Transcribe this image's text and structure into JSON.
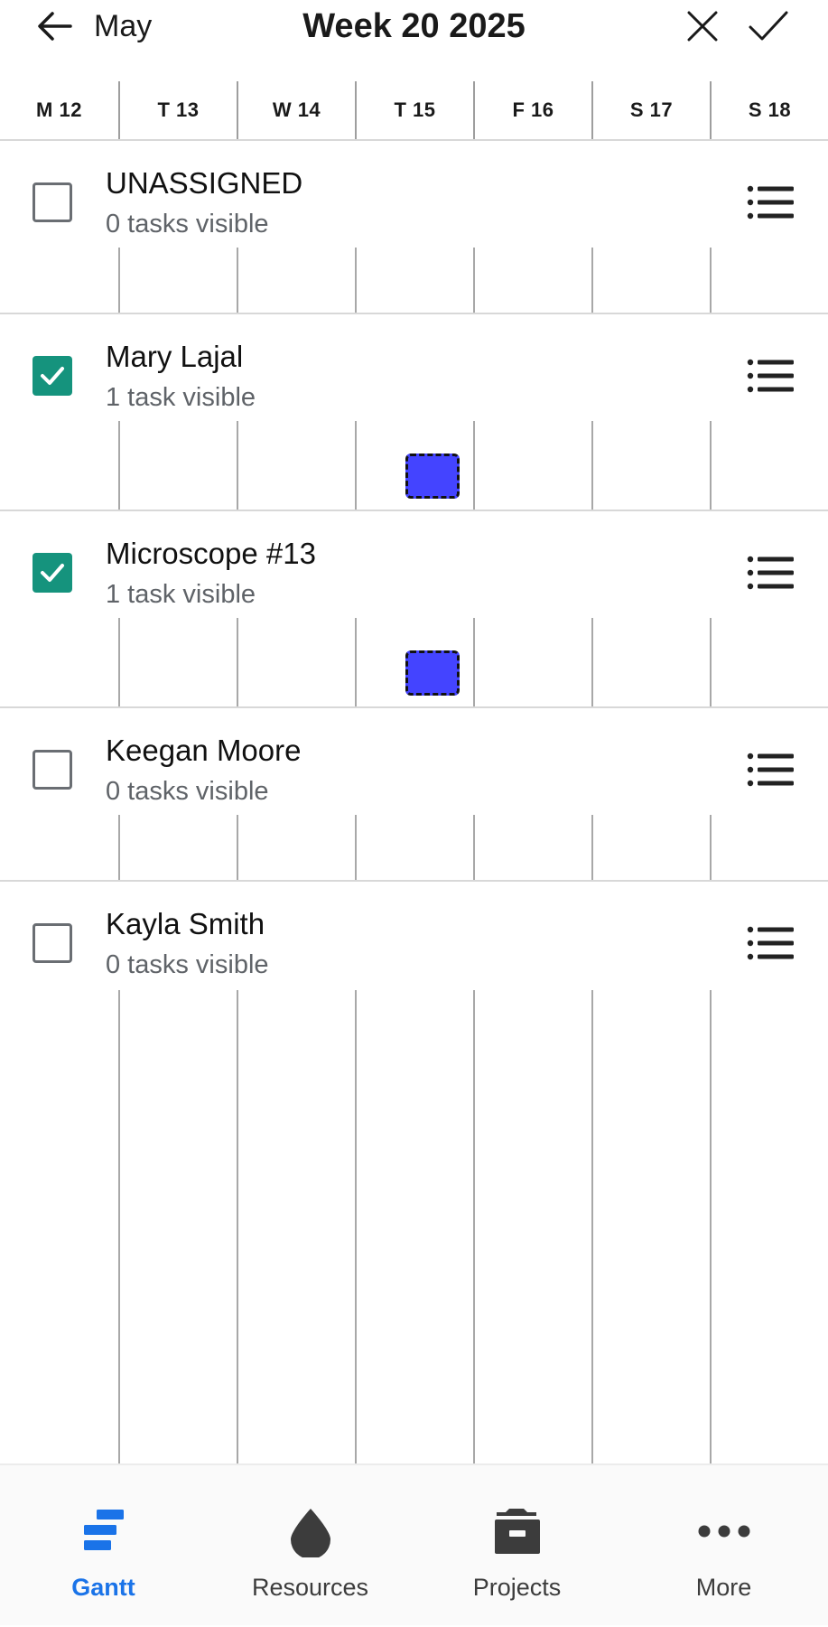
{
  "header": {
    "month_label": "May",
    "title": "Week 20 2025"
  },
  "days": [
    "M 12",
    "T 13",
    "W 14",
    "T 15",
    "F 16",
    "S 17",
    "S 18"
  ],
  "rows": [
    {
      "name": "UNASSIGNED",
      "subtitle": "0 tasks visible",
      "checked": false
    },
    {
      "name": "Mary Lajal",
      "subtitle": "1 task visible",
      "checked": true,
      "task_day": "T 15"
    },
    {
      "name": "Microscope #13",
      "subtitle": "1 task visible",
      "checked": true,
      "task_day": "T 15"
    },
    {
      "name": "Keegan Moore",
      "subtitle": "0 tasks visible",
      "checked": false
    },
    {
      "name": "Kayla Smith",
      "subtitle": "0 tasks visible",
      "checked": false
    }
  ],
  "bottom_nav": [
    {
      "label": "Gantt",
      "icon": "gantt-icon",
      "active": true
    },
    {
      "label": "Resources",
      "icon": "droplet-icon",
      "active": false
    },
    {
      "label": "Projects",
      "icon": "briefcase-icon",
      "active": false
    },
    {
      "label": "More",
      "icon": "more-dots-icon",
      "active": false
    }
  ],
  "colors": {
    "accent": "#1a73e8",
    "checkbox_checked": "#15937d",
    "task_block": "#4444ff"
  }
}
